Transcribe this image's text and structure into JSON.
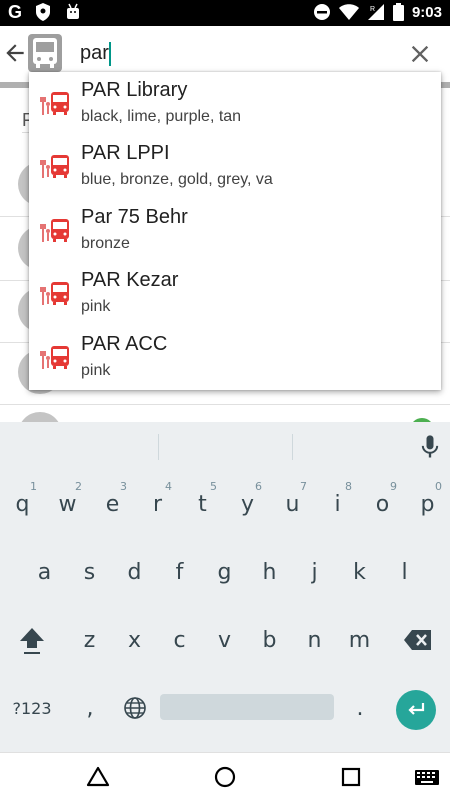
{
  "status_bar": {
    "time": "9:03",
    "google_icon_label": "G",
    "icons": [
      "shield-icon",
      "android-debug-icon",
      "do-not-disturb-icon",
      "wifi-icon",
      "signal-icon",
      "battery-icon"
    ]
  },
  "toolbar": {
    "search_value": "par",
    "back_icon": "arrow-back-icon",
    "app_icon": "bus-app-icon",
    "clear_icon": "close-icon"
  },
  "background_list": {
    "header": "F",
    "avatars": [
      "b",
      "b",
      "b",
      "g",
      ""
    ]
  },
  "suggestions": [
    {
      "title": "PAR Library",
      "subtitle": "black, lime, purple, tan",
      "icon": "bus-stop-icon"
    },
    {
      "title": "PAR LPPI",
      "subtitle": "blue, bronze, gold, grey, va",
      "icon": "bus-stop-icon"
    },
    {
      "title": "Par 75 Behr",
      "subtitle": "bronze",
      "icon": "bus-stop-icon"
    },
    {
      "title": "PAR Kezar",
      "subtitle": "pink",
      "icon": "bus-stop-icon"
    },
    {
      "title": "PAR ACC",
      "subtitle": "pink",
      "icon": "bus-stop-icon"
    }
  ],
  "keyboard": {
    "row1": [
      "q",
      "w",
      "e",
      "r",
      "t",
      "y",
      "u",
      "i",
      "o",
      "p"
    ],
    "row1_hints": [
      "1",
      "2",
      "3",
      "4",
      "5",
      "6",
      "7",
      "8",
      "9",
      "0"
    ],
    "row2": [
      "a",
      "s",
      "d",
      "f",
      "g",
      "h",
      "j",
      "k",
      "l"
    ],
    "row3": [
      "z",
      "x",
      "c",
      "v",
      "b",
      "n",
      "m"
    ],
    "symbols_label": "?123",
    "comma": ",",
    "period": ".",
    "shift_icon": "shift-icon",
    "backspace_icon": "backspace-icon",
    "globe_icon": "globe-icon",
    "enter_icon": "enter-icon",
    "mic_icon": "mic-icon"
  },
  "nav_bar": {
    "icons": [
      "back-triangle-icon",
      "home-circle-icon",
      "recents-square-icon",
      "keyboard-switch-icon"
    ]
  },
  "colors": {
    "accent": "#009688",
    "enter_key": "#26a69a",
    "bus_icon": "#e53935",
    "status_bar": "#000000",
    "keyboard_bg": "#eceff1"
  }
}
